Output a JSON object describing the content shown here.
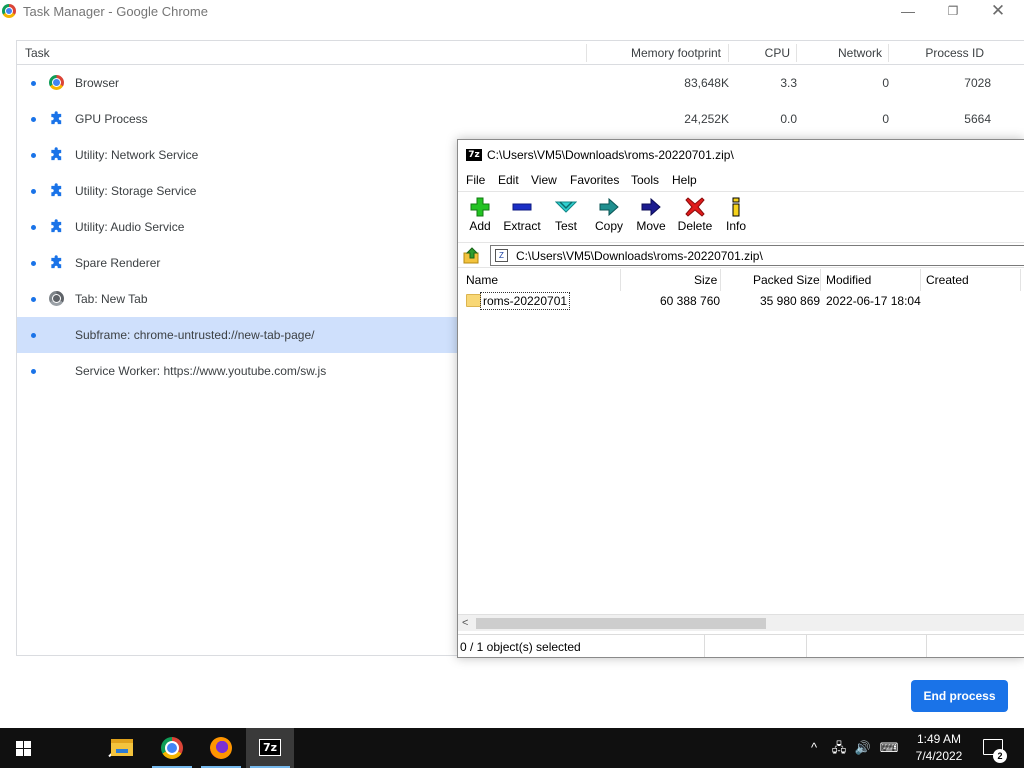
{
  "window": {
    "title": "Task Manager - Google Chrome",
    "minimize": "—",
    "maximize": "❐",
    "close": "✕"
  },
  "task_manager": {
    "columns": {
      "task": "Task",
      "memory": "Memory footprint",
      "cpu": "CPU",
      "network": "Network",
      "pid": "Process ID"
    },
    "rows": [
      {
        "icon": "chrome-icon",
        "name": "Browser",
        "memory": "83,648K",
        "cpu": "3.3",
        "network": "0",
        "pid": "7028"
      },
      {
        "icon": "puzzle-icon",
        "name": "GPU Process",
        "memory": "24,252K",
        "cpu": "0.0",
        "network": "0",
        "pid": "5664"
      },
      {
        "icon": "puzzle-icon",
        "name": "Utility: Network Service"
      },
      {
        "icon": "puzzle-icon",
        "name": "Utility: Storage Service"
      },
      {
        "icon": "puzzle-icon",
        "name": "Utility: Audio Service"
      },
      {
        "icon": "puzzle-icon",
        "name": "Spare Renderer"
      },
      {
        "icon": "chrome-gray-icon",
        "name": "Tab: New Tab"
      },
      {
        "icon": "",
        "name": "Subframe: chrome-untrusted://new-tab-page/",
        "selected": true
      },
      {
        "icon": "",
        "name": "Service Worker: https://www.youtube.com/sw.js"
      }
    ],
    "end_process_label": "End process",
    "accent_color": "#1a73e8",
    "selected_row_color": "#cfe0fc"
  },
  "sevenzip": {
    "logo": "7z",
    "title": "C:\\Users\\VM5\\Downloads\\roms-20220701.zip\\",
    "menu": [
      "File",
      "Edit",
      "View",
      "Favorites",
      "Tools",
      "Help"
    ],
    "toolbar": [
      {
        "label": "Add",
        "icon": "add-plus-icon"
      },
      {
        "label": "Extract",
        "icon": "extract-minus-icon"
      },
      {
        "label": "Test",
        "icon": "test-check-icon"
      },
      {
        "label": "Copy",
        "icon": "copy-arrow-icon"
      },
      {
        "label": "Move",
        "icon": "move-arrow-icon"
      },
      {
        "label": "Delete",
        "icon": "delete-x-icon"
      },
      {
        "label": "Info",
        "icon": "info-icon"
      }
    ],
    "path": "C:\\Users\\VM5\\Downloads\\roms-20220701.zip\\",
    "columns": {
      "name": "Name",
      "size": "Size",
      "packed": "Packed Size",
      "modified": "Modified",
      "created": "Created"
    },
    "files": [
      {
        "name": "roms-20220701",
        "size": "60 388 760",
        "packed": "35 980 869",
        "modified": "2022-06-17 18:04",
        "created": ""
      }
    ],
    "status": "0 / 1 object(s) selected",
    "scroll_left": "<"
  },
  "taskbar": {
    "clock_time": "1:49 AM",
    "clock_date": "7/4/2022",
    "notification_count": "2",
    "zip_label": "7z",
    "tray_chevron": "^",
    "tray_network": "🖧",
    "tray_volume": "🔊",
    "tray_keyboard": "⌨"
  }
}
